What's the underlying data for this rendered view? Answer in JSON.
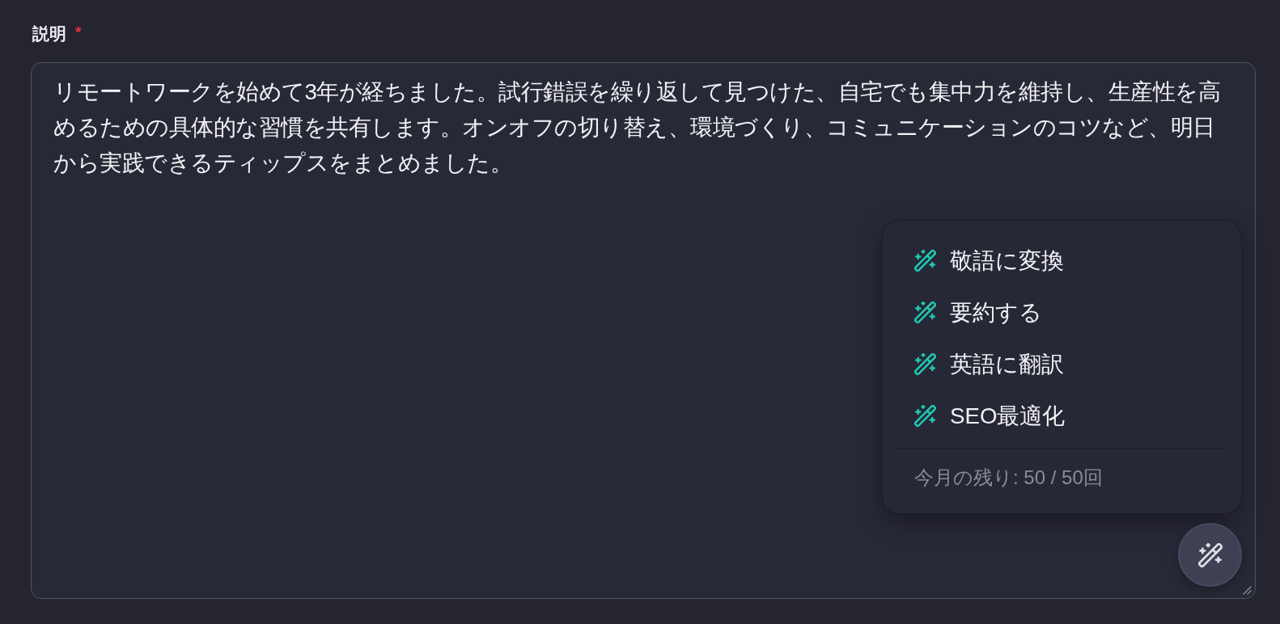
{
  "field": {
    "label": "説明",
    "required_mark": "*",
    "value": "リモートワークを始めて3年が経ちました。試行錯誤を繰り返して見つけた、自宅でも集中力を維持し、生産性を高めるための具体的な習慣を共有します。オンオフの切り替え、環境づくり、コミュニケーションのコツなど、明日から実践できるティップスをまとめました。"
  },
  "ai_menu": {
    "open": true,
    "items": [
      {
        "label": "敬語に変換"
      },
      {
        "label": "要約する"
      },
      {
        "label": "英語に翻訳"
      },
      {
        "label": "SEO最適化"
      }
    ],
    "usage": "今月の残り: 50 / 50回"
  }
}
